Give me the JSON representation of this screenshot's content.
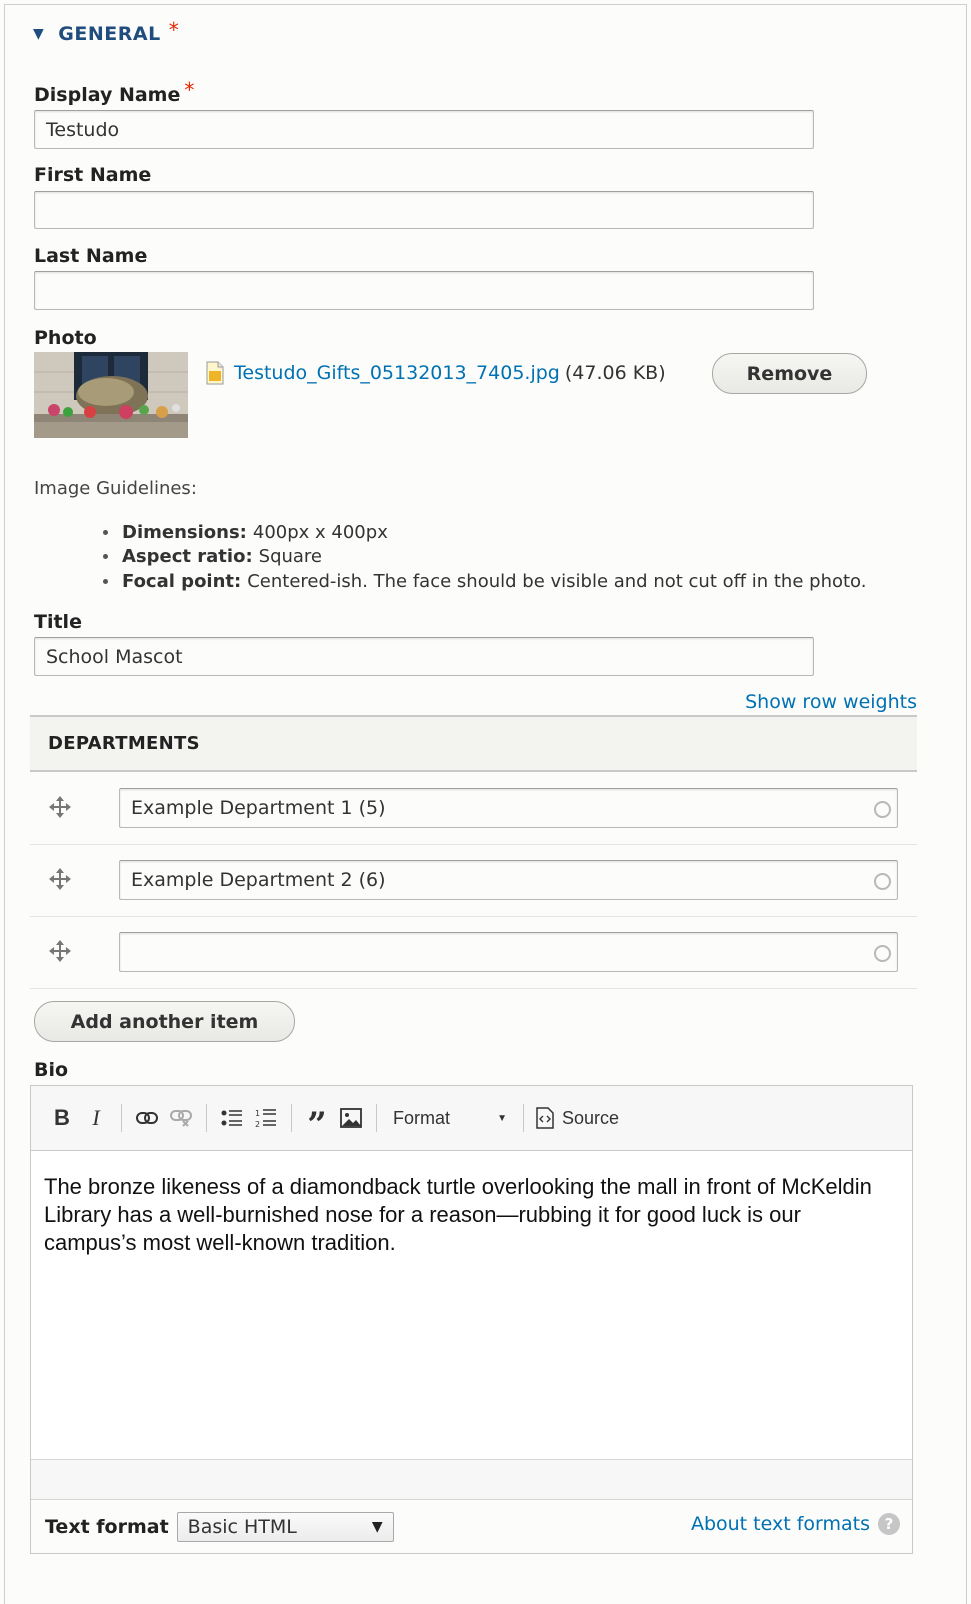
{
  "section": {
    "title": "GENERAL",
    "required_marker": "*",
    "expanded": true
  },
  "fields": {
    "display_name": {
      "label": "Display Name",
      "required_marker": "*",
      "value": "Testudo"
    },
    "first_name": {
      "label": "First Name",
      "value": ""
    },
    "last_name": {
      "label": "Last Name",
      "value": ""
    },
    "photo": {
      "label": "Photo",
      "file_name": "Testudo_Gifts_05132013_7405.jpg",
      "file_size": "(47.06 KB)",
      "remove_label": "Remove",
      "thumbnail_alt": "Testudo turtle statue with gifts"
    },
    "guidelines": {
      "heading": "Image Guidelines:",
      "items": [
        {
          "term": "Dimensions:",
          "text": "400px x 400px"
        },
        {
          "term": "Aspect ratio:",
          "text": "Square"
        },
        {
          "term": "Focal point:",
          "text": "Centered-ish. The face should be visible and not cut off in the photo."
        }
      ]
    },
    "title": {
      "label": "Title",
      "value": "School Mascot"
    }
  },
  "departments": {
    "show_weights_label": "Show row weights",
    "header": "DEPARTMENTS",
    "rows": [
      {
        "value": "Example Department 1 (5)"
      },
      {
        "value": "Example Department 2 (6)"
      },
      {
        "value": ""
      }
    ],
    "add_label": "Add another item"
  },
  "bio": {
    "label": "Bio",
    "toolbar": {
      "bold": "B",
      "italic": "I",
      "format_label": "Format",
      "source_label": "Source"
    },
    "content": "The bronze likeness of a diamondback turtle overlooking the mall in front of McKeldin Library has a well-burnished nose for a reason—rubbing it for good luck is our campus’s most well-known tradition.",
    "text_format_label": "Text format",
    "text_format_value": "Basic HTML",
    "about_formats_label": "About text formats",
    "help_glyph": "?"
  }
}
